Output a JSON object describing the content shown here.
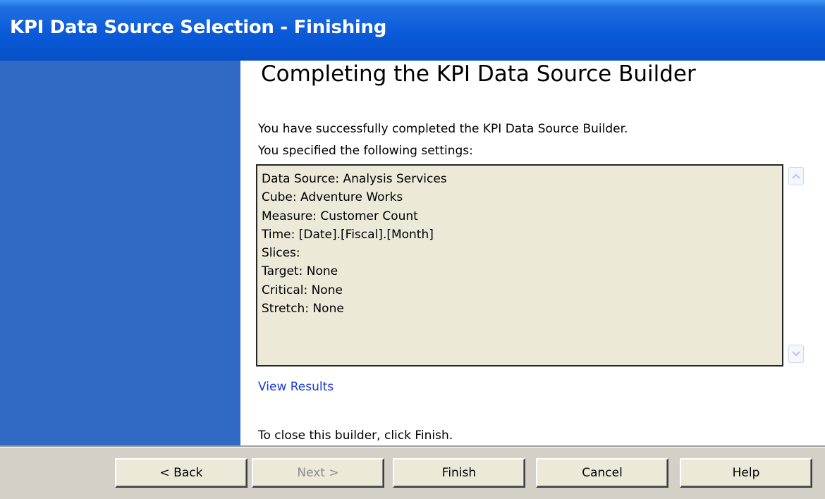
{
  "window": {
    "title": "KPI Data Source Selection - Finishing"
  },
  "main": {
    "heading": "Completing the KPI Data Source Builder",
    "success_text": "You have successfully completed the KPI Data Source Builder.",
    "settings_intro": "You specified the following settings:",
    "settings": [
      "Data Source: Analysis Services",
      "Cube: Adventure Works",
      "Measure: Customer Count",
      "Time: [Date].[Fiscal].[Month]",
      "Slices:",
      "Target: None",
      "Critical: None",
      "Stretch: None"
    ],
    "view_results_link": "View Results",
    "closing_text": "To close this builder, click Finish."
  },
  "buttons": {
    "back": "< Back",
    "next": "Next >",
    "finish": "Finish",
    "cancel": "Cancel",
    "help": "Help"
  },
  "colors": {
    "titlebar": "#0a5ad9",
    "sidebar": "#316ac5",
    "settings_background": "#ece9d8",
    "link": "#1a3bd6"
  }
}
